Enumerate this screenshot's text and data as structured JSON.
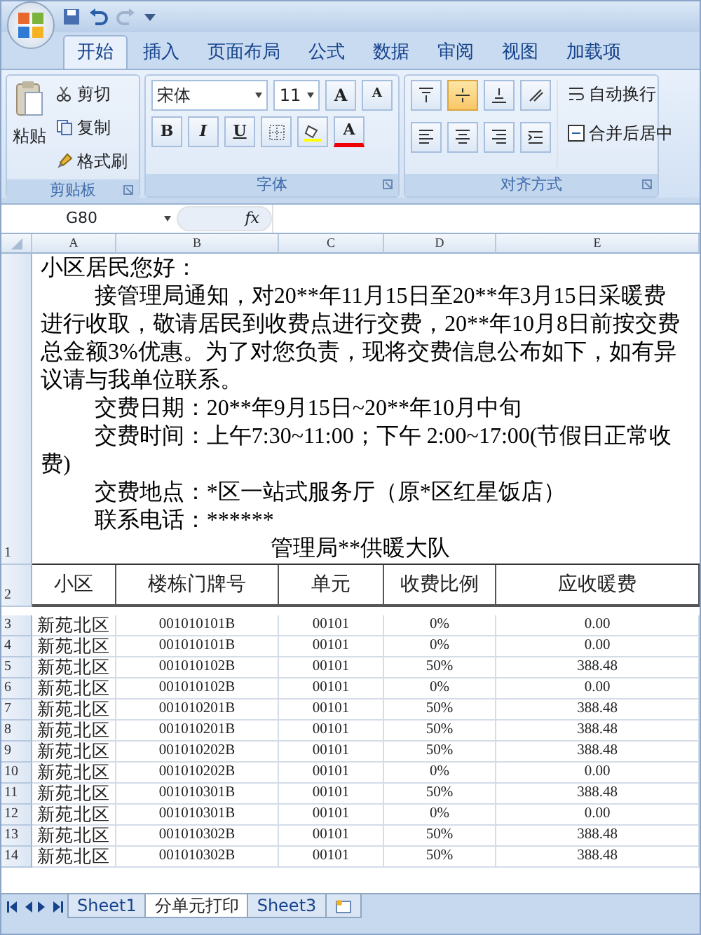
{
  "tabs": [
    {
      "label": "开始",
      "selected": true
    },
    {
      "label": "插入",
      "selected": false
    },
    {
      "label": "页面布局",
      "selected": false
    },
    {
      "label": "公式",
      "selected": false
    },
    {
      "label": "数据",
      "selected": false
    },
    {
      "label": "审阅",
      "selected": false
    },
    {
      "label": "视图",
      "selected": false
    },
    {
      "label": "加载项",
      "selected": false
    }
  ],
  "clipboard": {
    "title": "剪贴板",
    "paste": "粘贴",
    "cut": "剪切",
    "copy": "复制",
    "format_painter": "格式刷"
  },
  "font": {
    "title": "字体",
    "font_name": "宋体",
    "font_size": "11",
    "grow": "A",
    "shrink": "A",
    "bold": "B",
    "italic": "I",
    "underline": "U",
    "font_color": "A"
  },
  "alignment": {
    "title": "对齐方式",
    "vertical": [
      {
        "kind": "top",
        "selected": false
      },
      {
        "kind": "middle",
        "selected": true
      },
      {
        "kind": "bottom",
        "selected": false
      }
    ],
    "horizontal": [
      {
        "kind": "left",
        "selected": false
      },
      {
        "kind": "center",
        "selected": false
      },
      {
        "kind": "right",
        "selected": false
      }
    ],
    "wrap_text": "自动换行",
    "merge_center": "合并后居中"
  },
  "formula_bar": {
    "name_box": "G80",
    "fx": "fx"
  },
  "columns": [
    "A",
    "B",
    "C",
    "D",
    "E"
  ],
  "notice": {
    "row": "1",
    "paragraphs": [
      {
        "text": "小区居民您好：",
        "indent": false
      },
      {
        "text": "接管理局通知，对20**年11月15日至20**年3月15日采暖费进行收取，敬请居民到收费点进行交费，20**年10月8日前按交费总金额3%优惠。为了对您负责，现将交费信息公布如下，如有异议请与我单位联系。",
        "indent": true
      },
      {
        "text": "交费日期：20**年9月15日~20**年10月中旬",
        "indent": true
      },
      {
        "text": "交费时间：上午7:30~11:00；下午 2:00~17:00(节假日正常收费)",
        "indent": true
      },
      {
        "text": "交费地点：*区一站式服务厅（原*区红星饭店）",
        "indent": true
      },
      {
        "text": "联系电话：******",
        "indent": true
      }
    ],
    "signature": "管理局**供暖大队"
  },
  "table": {
    "header_row": "2",
    "headers": [
      "小区",
      "楼栋门牌号",
      "单元",
      "收费比例",
      "应收暖费"
    ],
    "rows": [
      {
        "row": "3",
        "cells": [
          "新苑北区",
          "001010101B",
          "00101",
          "0%",
          "0.00"
        ]
      },
      {
        "row": "4",
        "cells": [
          "新苑北区",
          "001010101B",
          "00101",
          "0%",
          "0.00"
        ]
      },
      {
        "row": "5",
        "cells": [
          "新苑北区",
          "001010102B",
          "00101",
          "50%",
          "388.48"
        ]
      },
      {
        "row": "6",
        "cells": [
          "新苑北区",
          "001010102B",
          "00101",
          "0%",
          "0.00"
        ]
      },
      {
        "row": "7",
        "cells": [
          "新苑北区",
          "001010201B",
          "00101",
          "50%",
          "388.48"
        ]
      },
      {
        "row": "8",
        "cells": [
          "新苑北区",
          "001010201B",
          "00101",
          "50%",
          "388.48"
        ]
      },
      {
        "row": "9",
        "cells": [
          "新苑北区",
          "001010202B",
          "00101",
          "50%",
          "388.48"
        ]
      },
      {
        "row": "10",
        "cells": [
          "新苑北区",
          "001010202B",
          "00101",
          "0%",
          "0.00"
        ]
      },
      {
        "row": "11",
        "cells": [
          "新苑北区",
          "001010301B",
          "00101",
          "50%",
          "388.48"
        ]
      },
      {
        "row": "12",
        "cells": [
          "新苑北区",
          "001010301B",
          "00101",
          "0%",
          "0.00"
        ]
      },
      {
        "row": "13",
        "cells": [
          "新苑北区",
          "001010302B",
          "00101",
          "50%",
          "388.48"
        ]
      },
      {
        "row": "14",
        "cells": [
          "新苑北区",
          "001010302B",
          "00101",
          "50%",
          "388.48"
        ]
      }
    ]
  },
  "sheet_tabs": [
    {
      "label": "Sheet1",
      "selected": false
    },
    {
      "label": "分单元打印",
      "selected": true
    },
    {
      "label": "Sheet3",
      "selected": false
    }
  ]
}
